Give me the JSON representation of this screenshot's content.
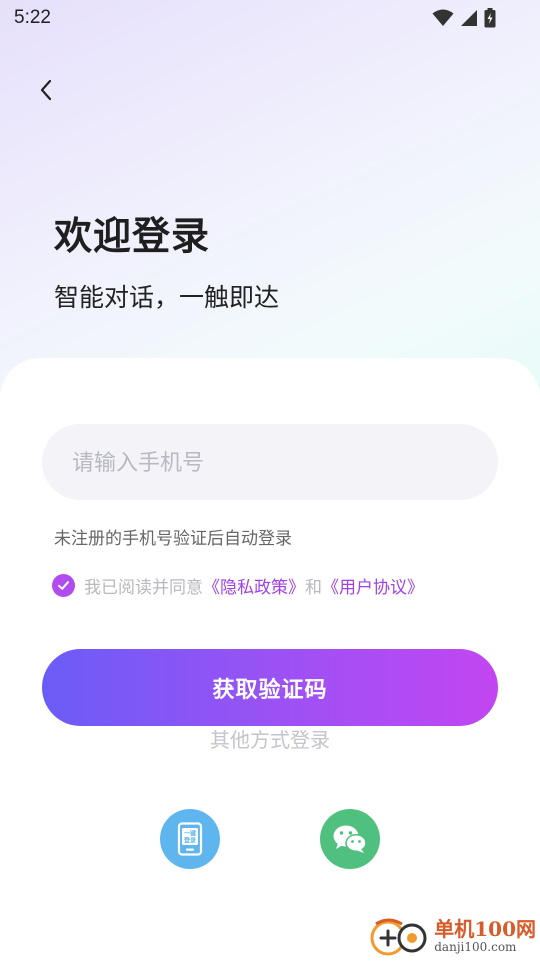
{
  "status_bar": {
    "time": "5:22",
    "icons": [
      "wifi-icon",
      "signal-icon",
      "battery-charging-icon"
    ]
  },
  "header": {
    "back_icon": "chevron-left-icon",
    "title": "欢迎登录",
    "subtitle": "智能对话，一触即达"
  },
  "form": {
    "phone_placeholder": "请输入手机号",
    "phone_value": "",
    "hint": "未注册的手机号验证后自动登录",
    "agreement": {
      "checked": true,
      "prefix": "我已阅读并同意",
      "privacy_link": "《隐私政策》",
      "conjunction": "和",
      "terms_link": "《用户协议》"
    },
    "submit_label": "获取验证码"
  },
  "other_login": {
    "label": "其他方式登录",
    "onekey": {
      "icon": "phone-onekey-icon",
      "icon_text_line1": "一键",
      "icon_text_line2": "登录"
    },
    "wechat": {
      "icon": "wechat-icon"
    }
  },
  "watermark": {
    "name": "单机100网",
    "url": "danji100.com"
  },
  "colors": {
    "accent_start": "#6b5cf7",
    "accent_end": "#c246f2",
    "link": "#a042e8",
    "onekey_bg": "#5fb6ee",
    "wechat_bg": "#4fc07e"
  }
}
